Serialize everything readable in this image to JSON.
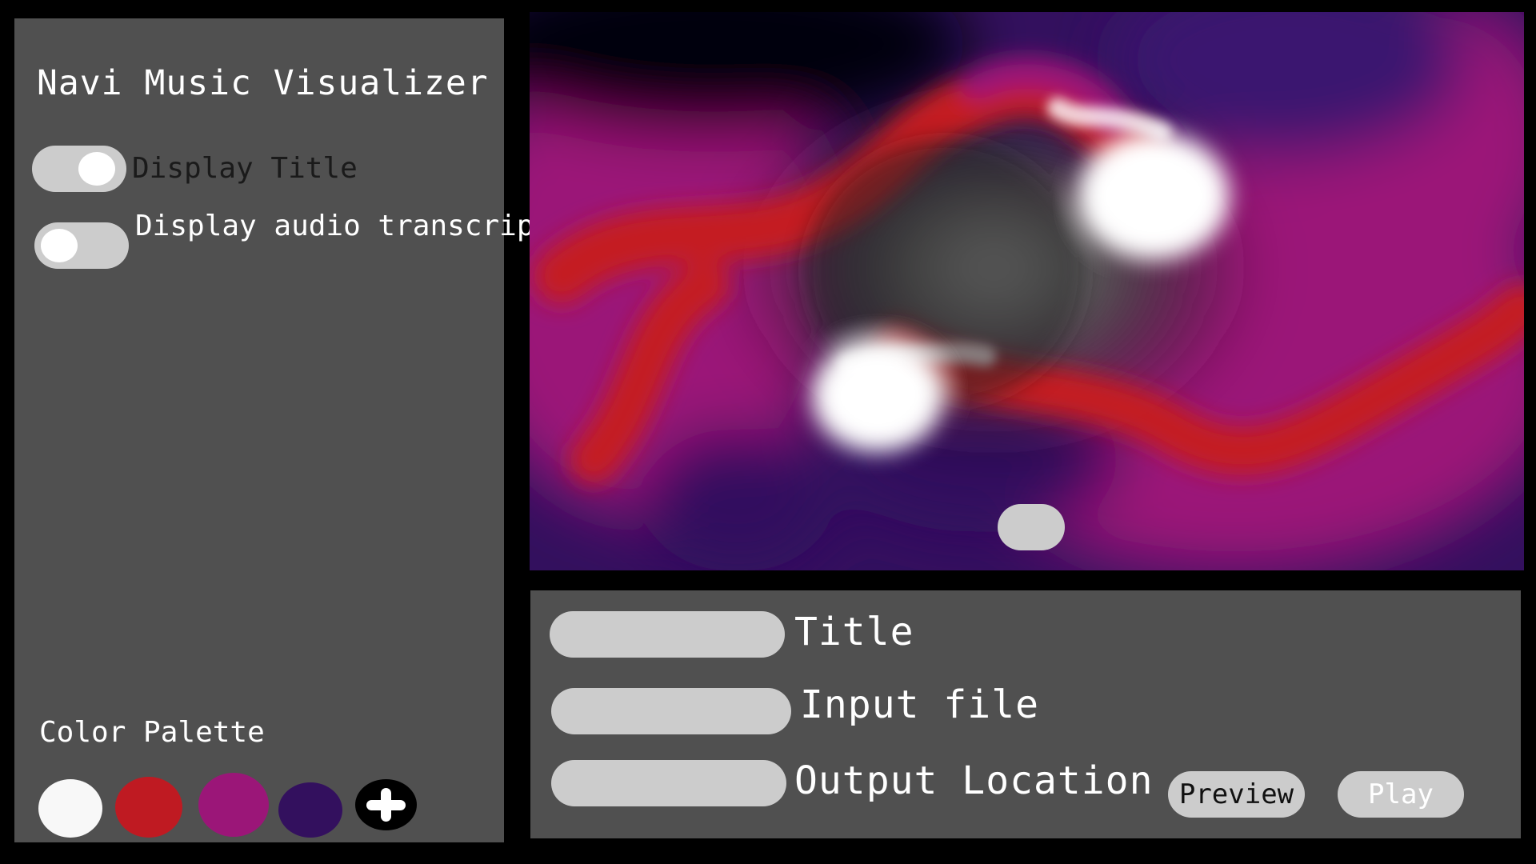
{
  "app": {
    "title": "Navi Music Visualizer"
  },
  "sidebar": {
    "toggles": [
      {
        "label": "Display Title",
        "state": "on"
      },
      {
        "label": "Display audio transcription",
        "state": "off"
      }
    ],
    "palette": {
      "label": "Color Palette",
      "colors": [
        "#f8f8f8",
        "#bf1a22",
        "#9b1678",
        "#33105e"
      ],
      "add_icon": "plus-icon"
    }
  },
  "visualizer": {
    "colors": {
      "background": "#1a0a30",
      "magenta": "#9b1678",
      "red": "#c41e24",
      "purple": "#33105e",
      "glow": "#ffffff"
    }
  },
  "form": {
    "fields": [
      {
        "label": "Title",
        "value": "",
        "placeholder": ""
      },
      {
        "label": "Input file",
        "value": "",
        "placeholder": ""
      },
      {
        "label": "Output Location",
        "value": "",
        "placeholder": ""
      }
    ],
    "buttons": {
      "preview_label": "Preview",
      "play_label": "Play"
    }
  }
}
